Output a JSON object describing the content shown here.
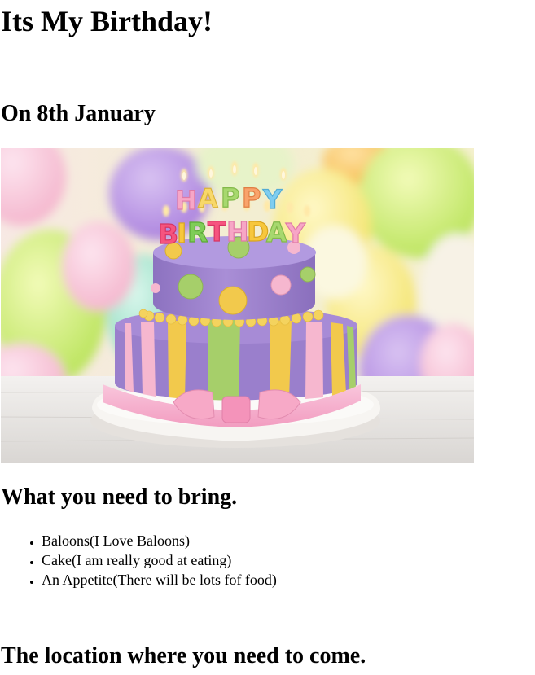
{
  "page": {
    "title": "Its My Birthday!",
    "date_heading": "On 8th January",
    "bring_heading": "What you need to bring.",
    "bring_items": [
      "Baloons(I Love Baloons)",
      "Cake(I am really good at eating)",
      "An Appetite(There will be lots fof food)"
    ],
    "location_heading": "The location where you need to come."
  },
  "image": {
    "semantic": "birthday-cake-photo",
    "candle_letters_line1": "HAPPY",
    "candle_letters_line2": "BIRTHDAY"
  },
  "colors": {
    "cake_purple": "#9b82c9",
    "cake_yellow": "#f2c94c",
    "cake_green": "#a6cf6a",
    "cake_pink": "#f6b3cf",
    "board": "#f4f1ee"
  }
}
